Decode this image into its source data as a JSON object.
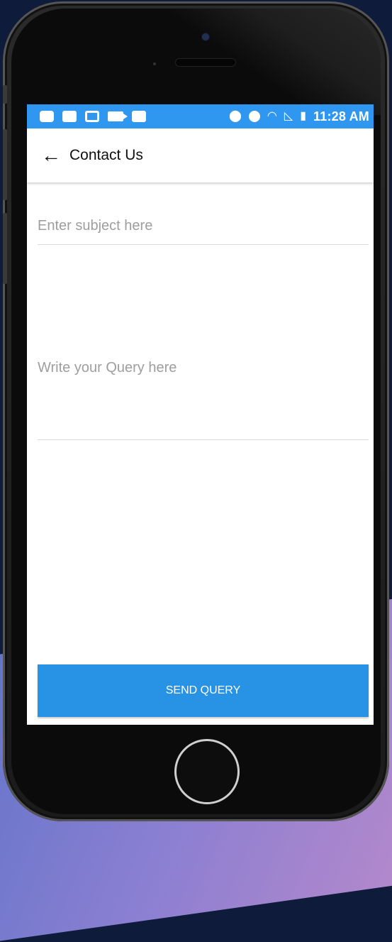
{
  "status_bar": {
    "time": "11:28 AM",
    "icons_left": [
      "message-icon",
      "square-icon",
      "mail-icon",
      "video-icon",
      "image-icon"
    ],
    "icons_right": [
      "location-icon",
      "dnd-icon",
      "wifi-icon",
      "no-sim-icon",
      "battery-charging-icon"
    ]
  },
  "app_bar": {
    "title": "Contact Us"
  },
  "form": {
    "subject_placeholder": "Enter  subject here",
    "query_placeholder": "Write your Query here",
    "send_label": "SEND QUERY"
  },
  "colors": {
    "primary": "#2f97f0",
    "button": "#2893e4"
  }
}
